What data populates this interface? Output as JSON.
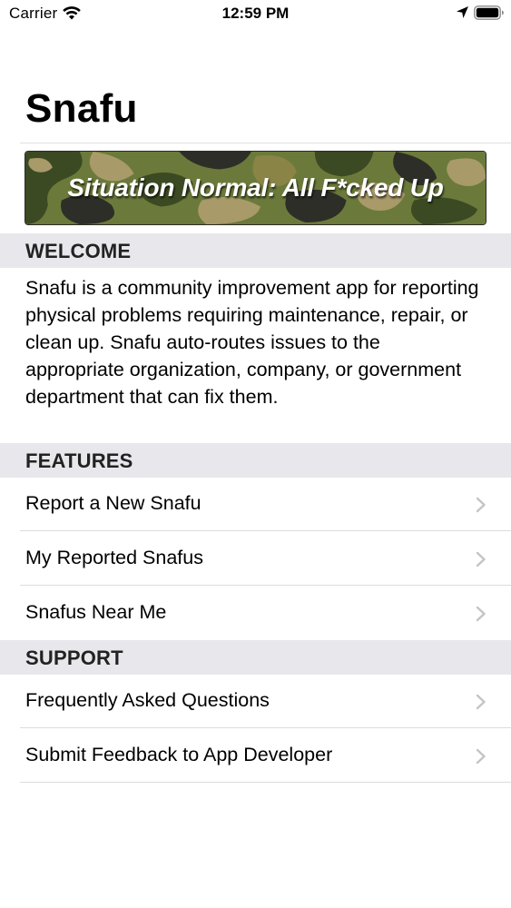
{
  "status_bar": {
    "carrier": "Carrier",
    "time": "12:59 PM",
    "icons": [
      "wifi-icon",
      "location-arrow-icon",
      "battery-icon"
    ]
  },
  "nav": {
    "title": "Snafu"
  },
  "banner": {
    "text": "Situation Normal: All F*cked Up",
    "style": "camouflage",
    "colors": [
      "#6b7a3a",
      "#3b4a22",
      "#a99a6a",
      "#2e2e28",
      "#8a8446"
    ]
  },
  "sections": {
    "welcome": {
      "header": "WELCOME",
      "body": "Snafu is a community improvement app for reporting physical problems requiring maintenance, repair, or clean up. Snafu auto-routes issues to the appropriate organization, company, or government department that can fix them."
    },
    "features": {
      "header": "FEATURES",
      "items": [
        {
          "label": "Report a New Snafu",
          "icon": "chevron-right-icon"
        },
        {
          "label": "My Reported Snafus",
          "icon": "chevron-right-icon"
        },
        {
          "label": "Snafus Near Me",
          "icon": "chevron-right-icon"
        }
      ]
    },
    "support": {
      "header": "SUPPORT",
      "items": [
        {
          "label": "Frequently Asked Questions",
          "icon": "chevron-right-icon"
        },
        {
          "label": "Submit Feedback to App Developer",
          "icon": "chevron-right-icon"
        }
      ]
    }
  },
  "theme": {
    "section_header_bg": "#e7e7ec",
    "chevron_color": "#c4c4c7",
    "divider_color": "#dcdce0"
  }
}
